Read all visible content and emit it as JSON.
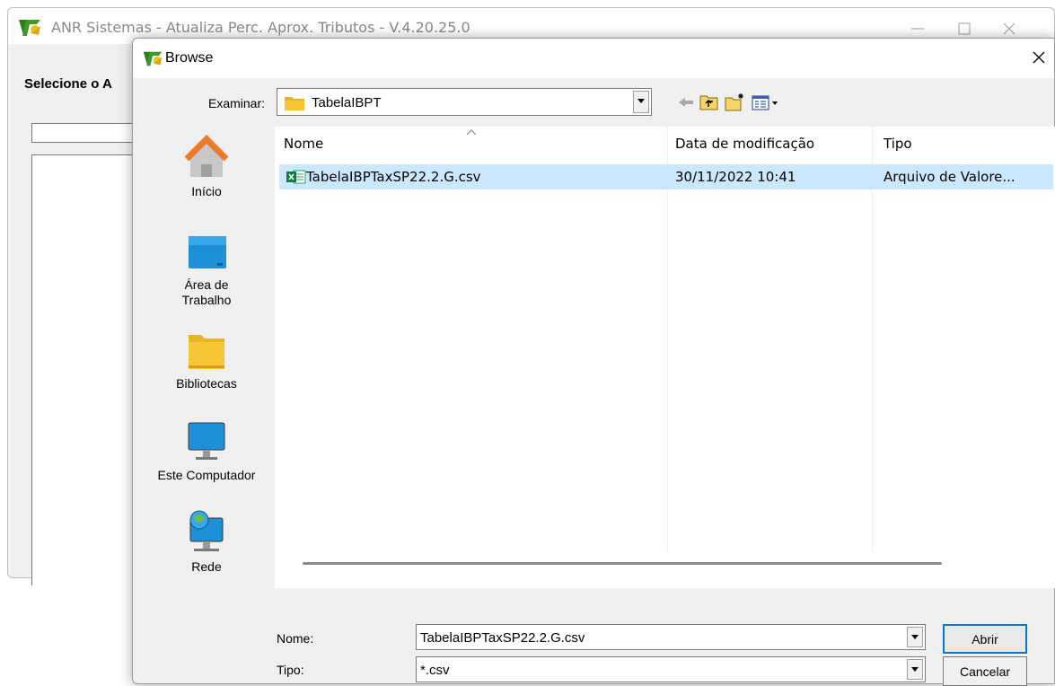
{
  "parent_window": {
    "title": "ANR Sistemas - Atualiza Perc. Aprox. Tributos - V.4.20.25.0",
    "heading": "Selecione o A"
  },
  "dialog": {
    "title": "Browse",
    "look_in_label": "Examinar:",
    "look_in_value": "TabelaIBPT",
    "places": [
      {
        "label": "Início",
        "icon": "home-icon"
      },
      {
        "label": "Área de\nTrabalho",
        "icon": "desktop-icon"
      },
      {
        "label": "Bibliotecas",
        "icon": "libraries-folder-icon"
      },
      {
        "label": "Este Computador",
        "icon": "computer-icon"
      },
      {
        "label": "Rede",
        "icon": "network-icon"
      }
    ],
    "columns": {
      "name": "Nome",
      "modified": "Data de modificação",
      "type": "Tipo"
    },
    "files": [
      {
        "name": "TabelaIBPTaxSP22.2.G.csv",
        "modified": "30/11/2022 10:41",
        "type": "Arquivo de Valore...",
        "icon": "excel-csv-icon"
      }
    ],
    "file_name_label": "Nome:",
    "file_name_value": "TabelaIBPTaxSP22.2.G.csv",
    "file_type_label": "Tipo:",
    "file_type_value": "*.csv",
    "open_button": "Abrir",
    "cancel_button": "Cancelar"
  },
  "colors": {
    "selection": "#cce8ff",
    "folder": "#f8c635",
    "accent": "#0078d7"
  }
}
